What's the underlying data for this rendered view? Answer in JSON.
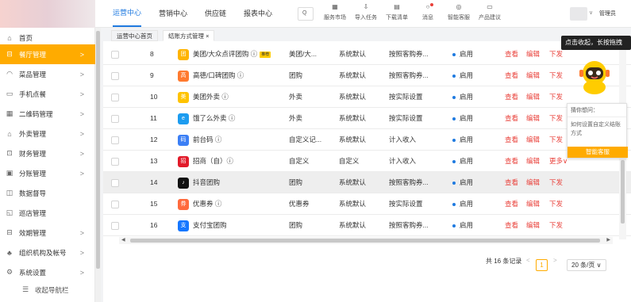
{
  "topnav": {
    "items": [
      "运营中心",
      "营销中心",
      "供应链",
      "报表中心"
    ],
    "search_icon": "Q",
    "tools": [
      {
        "icon": "market-icon",
        "label": "服务市场"
      },
      {
        "icon": "import-icon",
        "label": "导入任务"
      },
      {
        "icon": "download-icon",
        "label": "下载清单"
      },
      {
        "icon": "message-icon",
        "label": "消息"
      },
      {
        "icon": "service-icon",
        "label": "智能客服"
      },
      {
        "icon": "suggest-icon",
        "label": "产品建议"
      }
    ],
    "user_caret": "∨",
    "user_name": "管理员"
  },
  "sidebar": {
    "items": [
      {
        "icon": "home-icon",
        "label": "首页",
        "arrow": ""
      },
      {
        "icon": "restaurant-icon",
        "label": "餐厅管理",
        "arrow": ">"
      },
      {
        "icon": "dish-icon",
        "label": "菜品管理",
        "arrow": ">"
      },
      {
        "icon": "mobile-icon",
        "label": "手机点餐",
        "arrow": ">"
      },
      {
        "icon": "qrcode-icon",
        "label": "二维码管理",
        "arrow": ">"
      },
      {
        "icon": "takeout-icon",
        "label": "外卖管理",
        "arrow": ">"
      },
      {
        "icon": "finance-icon",
        "label": "财务管理",
        "arrow": ">"
      },
      {
        "icon": "branch-icon",
        "label": "分账管理",
        "arrow": ">"
      },
      {
        "icon": "monitor-icon",
        "label": "数据督导",
        "arrow": ""
      },
      {
        "icon": "inspect-icon",
        "label": "巡店管理",
        "arrow": ""
      },
      {
        "icon": "performance-icon",
        "label": "效期管理",
        "arrow": ">"
      },
      {
        "icon": "org-icon",
        "label": "组织机构及帐号",
        "arrow": ">"
      },
      {
        "icon": "settings-icon",
        "label": "系统设置",
        "arrow": ">"
      },
      {
        "icon": "collapse-icon",
        "label": "收起导航栏",
        "arrow": ""
      }
    ]
  },
  "tabs": [
    {
      "label": "运营中心首页"
    },
    {
      "label": "结账方式管理 ×"
    }
  ],
  "table": {
    "rows": [
      {
        "index": "8",
        "name": "美团/大众点评团购 ⓘ",
        "badge": "推荐",
        "icon_text": "团",
        "icon_color": "#ffb400",
        "type": "美团/大...",
        "source": "系统默认",
        "method": "按照客购券...",
        "status": "启用",
        "actions": [
          "查看",
          "编辑",
          "下发"
        ]
      },
      {
        "index": "9",
        "name": "高德/口碑团购 ⓘ",
        "icon_text": "高",
        "icon_color": "#ff7a2f",
        "type": "团购",
        "source": "系统默认",
        "method": "按照客购券...",
        "status": "启用",
        "actions": [
          "查看",
          "编辑",
          "下发"
        ]
      },
      {
        "index": "10",
        "name": "美团外卖 ⓘ",
        "icon_text": "美",
        "icon_color": "#ffc300",
        "type": "外卖",
        "source": "系统默认",
        "method": "按实际设置",
        "status": "启用",
        "actions": [
          "查看",
          "编辑",
          "下发"
        ]
      },
      {
        "index": "11",
        "name": "饿了么外卖 ⓘ",
        "icon_text": "e",
        "icon_color": "#1c9cf0",
        "type": "外卖",
        "source": "系统默认",
        "method": "按实际设置",
        "status": "启用",
        "actions": [
          "查看",
          "编辑",
          "下发"
        ]
      },
      {
        "index": "12",
        "name": "前台码 ⓘ",
        "icon_text": "码",
        "icon_color": "#3b7ff5",
        "type": "自定义记...",
        "source": "系统默认",
        "method": "计入收入",
        "status": "启用",
        "actions": [
          "查看",
          "编辑",
          "下发"
        ]
      },
      {
        "index": "13",
        "name": "招商（自）ⓘ",
        "icon_text": "招",
        "icon_color": "#e21b2a",
        "type": "自定义",
        "source": "自定义",
        "method": "计入收入",
        "status": "启用",
        "actions": [
          "查看",
          "编辑",
          "更多∨"
        ]
      },
      {
        "index": "14",
        "name": "抖音团购",
        "icon_text": "♪",
        "icon_color": "#111111",
        "type": "团购",
        "source": "系统默认",
        "method": "按照客购券...",
        "status": "启用",
        "actions": [
          "查看",
          "编辑",
          "下发"
        ]
      },
      {
        "index": "15",
        "name": "优惠券 ⓘ",
        "icon_text": "券",
        "icon_color": "#ff6a3d",
        "type": "优惠券",
        "source": "系统默认",
        "method": "按实际设置",
        "status": "启用",
        "actions": [
          "查看",
          "编辑",
          "下发"
        ]
      },
      {
        "index": "16",
        "name": "支付宝团购",
        "icon_text": "支",
        "icon_color": "#1677ff",
        "type": "团购",
        "source": "系统默认",
        "method": "按照客购券...",
        "status": "启用",
        "actions": [
          "查看",
          "编辑",
          "下发"
        ]
      }
    ]
  },
  "pagination": {
    "total": "共 16 条记录",
    "prev": "<",
    "current": "1",
    "next": ">",
    "page_size": "20 条/页 ∨"
  },
  "assistant": {
    "tip": "点击收起，长按拖拽",
    "card_title": "猜你想问：",
    "card_question": "如何设置自定义结账方式",
    "card_button": "智能客服"
  },
  "colors": {
    "accent": "#ffab00",
    "link": "#1f7ae0",
    "danger": "#e9403a"
  }
}
